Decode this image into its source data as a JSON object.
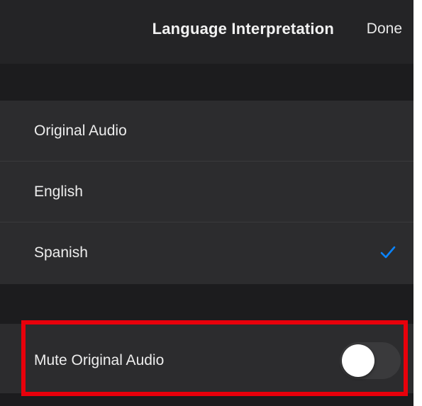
{
  "header": {
    "title": "Language Interpretation",
    "done_label": "Done"
  },
  "languages": [
    {
      "label": "Original Audio",
      "selected": false
    },
    {
      "label": "English",
      "selected": false
    },
    {
      "label": "Spanish",
      "selected": true
    }
  ],
  "mute_original": {
    "label": "Mute Original Audio",
    "enabled": false
  },
  "colors": {
    "accent": "#0a84ff",
    "highlight": "#e8000b",
    "background": "#1c1c1e",
    "row_background": "#2c2c2e"
  },
  "icons": {
    "selected_marker": "checkmark-icon"
  }
}
